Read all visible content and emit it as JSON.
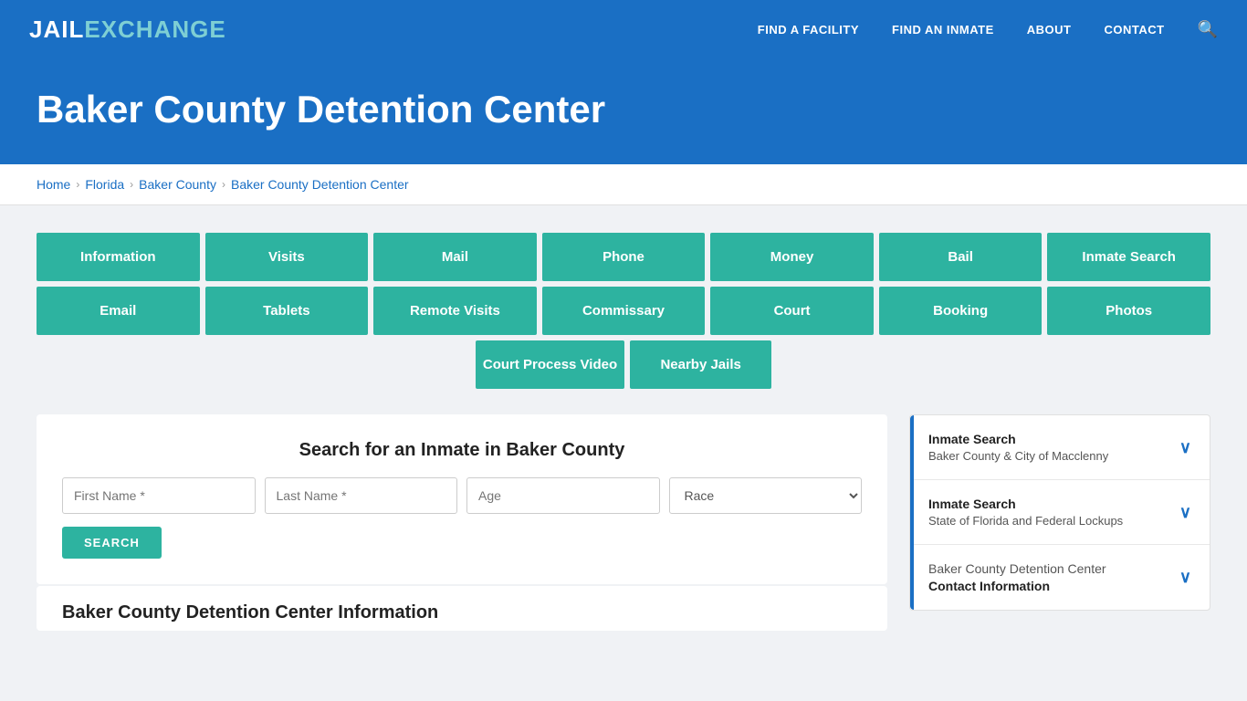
{
  "navbar": {
    "logo_jail": "JAIL",
    "logo_exchange": "EXCHANGE",
    "links": [
      {
        "label": "FIND A FACILITY",
        "name": "find-a-facility"
      },
      {
        "label": "FIND AN INMATE",
        "name": "find-an-inmate"
      },
      {
        "label": "ABOUT",
        "name": "about"
      },
      {
        "label": "CONTACT",
        "name": "contact"
      }
    ],
    "search_icon": "🔍"
  },
  "hero": {
    "title": "Baker County Detention Center"
  },
  "breadcrumb": {
    "items": [
      {
        "label": "Home",
        "name": "breadcrumb-home"
      },
      {
        "label": "Florida",
        "name": "breadcrumb-florida"
      },
      {
        "label": "Baker County",
        "name": "breadcrumb-baker-county"
      },
      {
        "label": "Baker County Detention Center",
        "name": "breadcrumb-current"
      }
    ]
  },
  "grid_buttons_row1": [
    {
      "label": "Information",
      "name": "btn-information"
    },
    {
      "label": "Visits",
      "name": "btn-visits"
    },
    {
      "label": "Mail",
      "name": "btn-mail"
    },
    {
      "label": "Phone",
      "name": "btn-phone"
    },
    {
      "label": "Money",
      "name": "btn-money"
    },
    {
      "label": "Bail",
      "name": "btn-bail"
    },
    {
      "label": "Inmate Search",
      "name": "btn-inmate-search"
    }
  ],
  "grid_buttons_row2": [
    {
      "label": "Email",
      "name": "btn-email"
    },
    {
      "label": "Tablets",
      "name": "btn-tablets"
    },
    {
      "label": "Remote Visits",
      "name": "btn-remote-visits"
    },
    {
      "label": "Commissary",
      "name": "btn-commissary"
    },
    {
      "label": "Court",
      "name": "btn-court"
    },
    {
      "label": "Booking",
      "name": "btn-booking"
    },
    {
      "label": "Photos",
      "name": "btn-photos"
    }
  ],
  "grid_buttons_row3": [
    {
      "label": "Court Process Video",
      "name": "btn-court-process-video"
    },
    {
      "label": "Nearby Jails",
      "name": "btn-nearby-jails"
    }
  ],
  "search": {
    "title": "Search for an Inmate in Baker County",
    "first_name_placeholder": "First Name *",
    "last_name_placeholder": "Last Name *",
    "age_placeholder": "Age",
    "race_placeholder": "Race",
    "button_label": "SEARCH"
  },
  "sidebar": {
    "items": [
      {
        "title": "Inmate Search",
        "subtitle": "Baker County & City of Macclenny",
        "name": "sidebar-inmate-search-county"
      },
      {
        "title": "Inmate Search",
        "subtitle": "State of Florida and Federal Lockups",
        "name": "sidebar-inmate-search-state"
      },
      {
        "title": "Baker County Detention Center",
        "subtitle": "Contact Information",
        "name": "sidebar-contact-info",
        "is_contact": true
      }
    ]
  },
  "section_heading": "Baker County Detention Center Information"
}
